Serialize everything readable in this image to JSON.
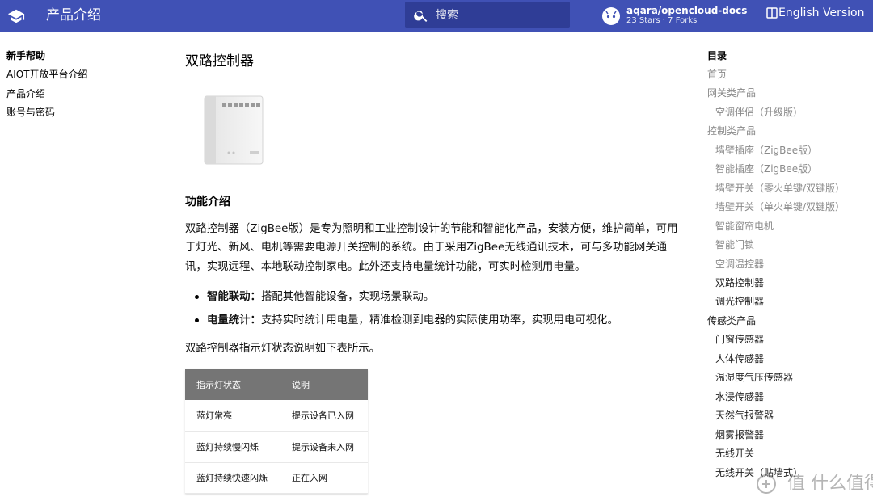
{
  "header": {
    "site_title": "产品介绍",
    "search_placeholder": "搜索",
    "repo_name": "aqara/opencloud-docs",
    "repo_stats": "23 Stars · 7 Forks",
    "language": "English Version",
    "accent_color": "#4051b5"
  },
  "left_nav": {
    "title": "新手帮助",
    "items": [
      "AIOT开放平台介绍",
      "产品介绍",
      "账号与密码"
    ]
  },
  "main": {
    "title": "双路控制器",
    "section_heading": "功能介绍",
    "intro": "双路控制器（ZigBee版）是专为照明和工业控制设计的节能和智能化产品，安装方便，维护简单，可用于灯光、新风、电机等需要电源开关控制的系统。由于采用ZigBee无线通讯技术，可与多功能网关通讯，实现远程、本地联动控制家电。此外还支持电量统计功能，可实时检测用电量。",
    "features": [
      {
        "label": "智能联动：",
        "text": "搭配其他智能设备，实现场景联动。"
      },
      {
        "label": "电量统计：",
        "text": "支持实时统计用电量，精准检测到电器的实际使用功率，实现用电可视化。"
      }
    ],
    "table_caption": "双路控制器指示灯状态说明如下表所示。",
    "table": {
      "headers": [
        "指示灯状态",
        "说明"
      ],
      "rows": [
        [
          "蓝灯常亮",
          "提示设备已入网"
        ],
        [
          "蓝灯持续慢闪烁",
          "提示设备未入网"
        ],
        [
          "蓝灯持续快速闪烁",
          "正在入网"
        ]
      ]
    }
  },
  "toc": {
    "title": "目录",
    "items": [
      {
        "label": "首页",
        "level": 0,
        "style": "muted"
      },
      {
        "label": "网关类产品",
        "level": 0,
        "style": "muted"
      },
      {
        "label": "空调伴侣（升级版）",
        "level": 1,
        "style": "muted"
      },
      {
        "label": "控制类产品",
        "level": 0,
        "style": "muted"
      },
      {
        "label": "墙壁插座（ZigBee版）",
        "level": 1,
        "style": "muted"
      },
      {
        "label": "智能插座（ZigBee版）",
        "level": 1,
        "style": "muted"
      },
      {
        "label": "墙壁开关（零火单键/双键版）",
        "level": 1,
        "style": "muted"
      },
      {
        "label": "墙壁开关（单火单键/双键版）",
        "level": 1,
        "style": "muted"
      },
      {
        "label": "智能窗帘电机",
        "level": 1,
        "style": "muted"
      },
      {
        "label": "智能门锁",
        "level": 1,
        "style": "muted"
      },
      {
        "label": "空调温控器",
        "level": 1,
        "style": "muted"
      },
      {
        "label": "双路控制器",
        "level": 1,
        "style": "dark"
      },
      {
        "label": "调光控制器",
        "level": 1,
        "style": "dark"
      },
      {
        "label": "传感类产品",
        "level": 0,
        "style": "dark"
      },
      {
        "label": "门窗传感器",
        "level": 1,
        "style": "dark"
      },
      {
        "label": "人体传感器",
        "level": 1,
        "style": "dark"
      },
      {
        "label": "温湿度气压传感器",
        "level": 1,
        "style": "dark"
      },
      {
        "label": "水浸传感器",
        "level": 1,
        "style": "dark"
      },
      {
        "label": "天然气报警器",
        "level": 1,
        "style": "dark"
      },
      {
        "label": "烟雾报警器",
        "level": 1,
        "style": "dark"
      },
      {
        "label": "无线开关",
        "level": 1,
        "style": "dark"
      },
      {
        "label": "无线开关（贴墙式）",
        "level": 1,
        "style": "dark"
      }
    ]
  },
  "watermark": "值 什么值得买"
}
